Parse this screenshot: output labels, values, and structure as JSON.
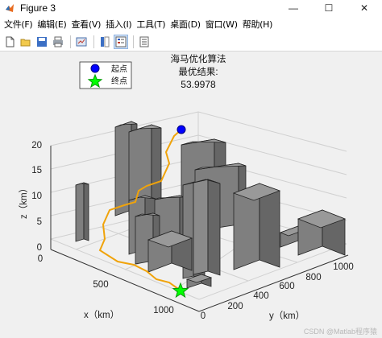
{
  "window": {
    "title": "Figure 3",
    "controls": {
      "minimize": "—",
      "maximize": "☐",
      "close": "✕"
    }
  },
  "menu": [
    "文件(F)",
    "编辑(E)",
    "查看(V)",
    "插入(I)",
    "工具(T)",
    "桌面(D)",
    "窗口(W)",
    "帮助(H)"
  ],
  "toolbar": {
    "icons": [
      "new-figure-icon",
      "open-file-icon",
      "save-icon",
      "print-icon",
      "link-plot-icon",
      "insert-colorbar-icon",
      "insert-legend-icon",
      "property-inspector-icon"
    ]
  },
  "plot": {
    "title_lines": [
      "海马优化算法",
      "最优结果:",
      "53.9978"
    ],
    "legend": [
      {
        "label": "起点",
        "marker": "circle",
        "color": "#0000ff"
      },
      {
        "label": "终点",
        "marker": "pentagram",
        "color": "#00ff00"
      }
    ],
    "z_axis": {
      "label": "z（km）",
      "ticks": [
        "0",
        "5",
        "10",
        "15",
        "20"
      ]
    },
    "x_axis": {
      "label": "x（km）",
      "ticks": [
        "0",
        "500",
        "1000"
      ]
    },
    "y_axis": {
      "label": "y（km）",
      "ticks": [
        "0",
        "200",
        "400",
        "600",
        "800",
        "1000"
      ]
    },
    "colors": {
      "obstacle": "#7f7f7f",
      "path": "#f0a30a",
      "start": "#0000ff",
      "end": "#00ff00"
    }
  },
  "watermark": "CSDN @Matlab程序猿"
}
